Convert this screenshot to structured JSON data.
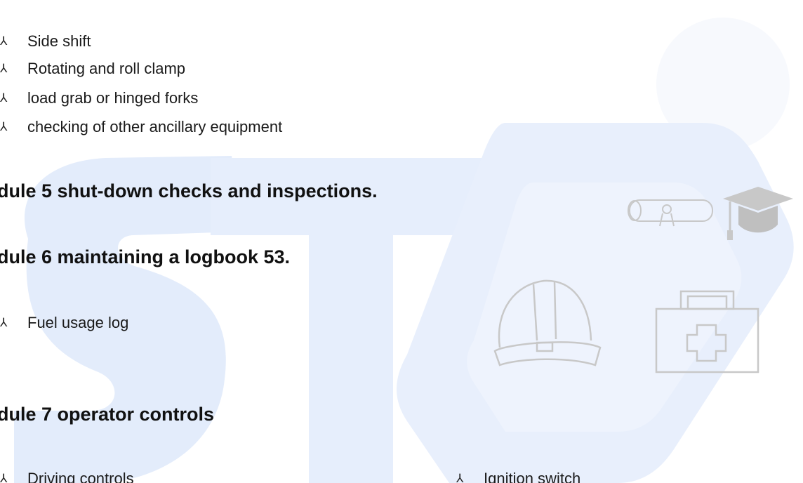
{
  "list_top": {
    "items": [
      "Side shift",
      "Rotating and roll clamp",
      "load grab or hinged forks",
      "checking of other ancillary equipment"
    ]
  },
  "headings": {
    "module5": "dule 5 shut-down checks and inspections.",
    "module6": "dule 6 maintaining a logbook 53.",
    "module7": "dule 7 operator controls"
  },
  "module6_items": [
    "Fuel usage log"
  ],
  "module7_items": {
    "left": "Driving controls",
    "right": "Ignition switch"
  },
  "bullet_glyph": "⅄",
  "colors": {
    "watermark_blue": "#e3ecfb",
    "watermark_light": "#eef3fc",
    "icon_gray": "#c8c8c8"
  },
  "watermark_icons": [
    "diploma-icon",
    "graduation-cap-icon",
    "hard-hat-icon",
    "first-aid-kit-icon"
  ]
}
